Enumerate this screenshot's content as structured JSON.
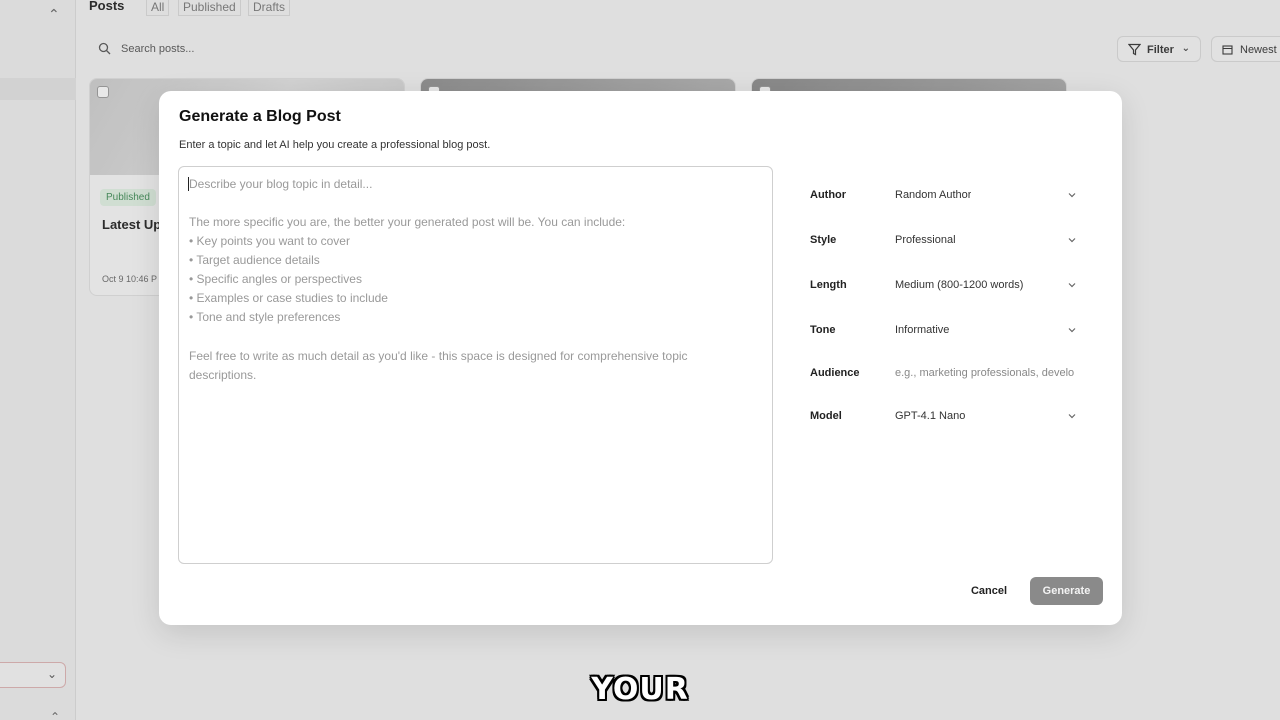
{
  "app": {
    "posts_title": "Posts",
    "tabs": [
      {
        "label": "All"
      },
      {
        "label": "Published"
      },
      {
        "label": "Drafts"
      }
    ],
    "search_placeholder": "Search posts...",
    "filter_label": "Filter",
    "sort_label": "Newest",
    "cards": [
      {
        "status": "Published",
        "title": "Latest Up",
        "date": "Oct 9 10:46 P"
      },
      {
        "status": "",
        "title": "",
        "date": ""
      },
      {
        "status": "",
        "title": "",
        "date": ""
      }
    ]
  },
  "modal": {
    "title": "Generate a Blog Post",
    "description": "Enter a topic and let AI help you create a professional blog post.",
    "topic_placeholder_lines": [
      "Describe your blog topic in detail...",
      "",
      "The more specific you are, the better your generated post will be. You can include:",
      "• Key points you want to cover",
      "• Target audience details",
      "• Specific angles or perspectives",
      "• Examples or case studies to include",
      "• Tone and style preferences",
      "",
      "Feel free to write as much detail as you'd like - this space is designed for comprehensive topic",
      "descriptions."
    ],
    "fields": {
      "author": {
        "label": "Author",
        "value": "Random Author"
      },
      "style": {
        "label": "Style",
        "value": "Professional"
      },
      "length": {
        "label": "Length",
        "value": "Medium (800-1200 words)"
      },
      "tone": {
        "label": "Tone",
        "value": "Informative"
      },
      "audience": {
        "label": "Audience",
        "placeholder": "e.g., marketing professionals, develo"
      },
      "model": {
        "label": "Model",
        "value": "GPT-4.1 Nano"
      }
    },
    "cancel_label": "Cancel",
    "generate_label": "Generate"
  },
  "caption": "YOUR",
  "colors": {
    "primary_disabled": "#8a8a8a",
    "published_badge": "#3f8a55"
  }
}
